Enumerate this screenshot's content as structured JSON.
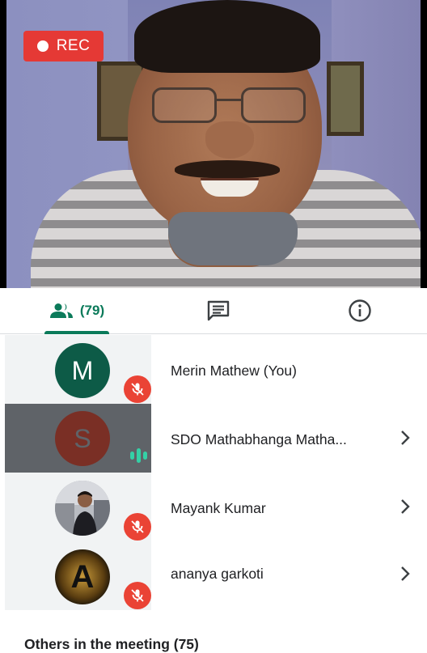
{
  "recording": {
    "label": "REC",
    "color": "#e53935"
  },
  "tabs": {
    "people_count": "(79)",
    "accent": "#0b7a5a"
  },
  "participants": [
    {
      "initial": "M",
      "name": "Merin Mathew (You)",
      "avatar_color": "#0d5b47",
      "mic": "muted",
      "has_chevron": false
    },
    {
      "initial": "S",
      "name": "SDO Mathabhanga Matha...",
      "avatar_color": "#7a2f25",
      "mic": "speaking",
      "has_chevron": true
    },
    {
      "initial": "",
      "name": "Mayank Kumar",
      "avatar_color": "#888888",
      "mic": "muted",
      "has_chevron": true
    },
    {
      "initial": "A",
      "name": "ananya garkoti",
      "avatar_color": "#111111",
      "mic": "muted",
      "has_chevron": true
    }
  ],
  "others_label": "Others in the meeting (75)"
}
